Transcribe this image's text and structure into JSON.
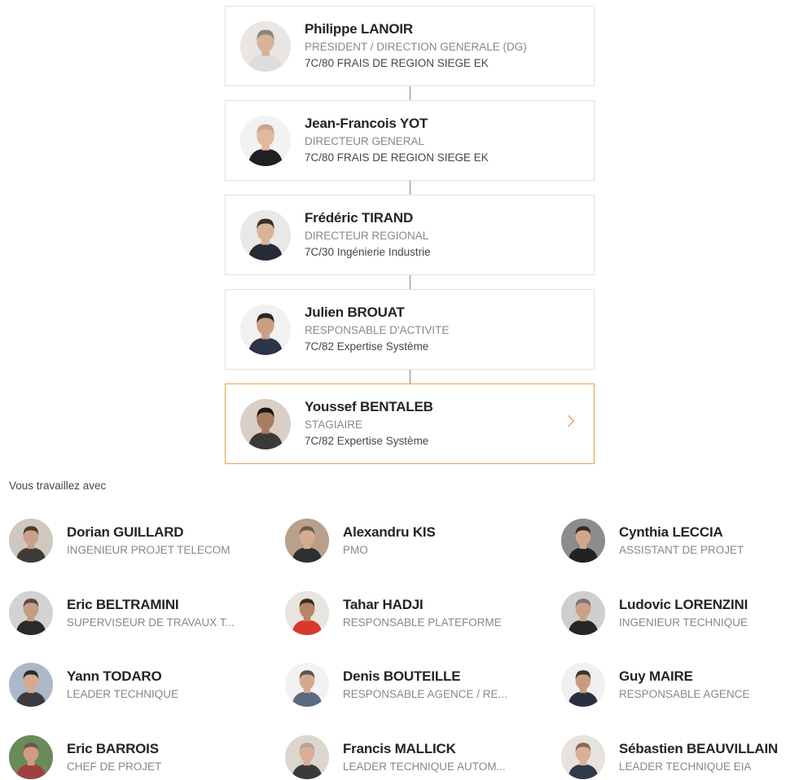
{
  "manager_chain": [
    {
      "name": "Philippe LANOIR",
      "role": "PRESIDENT / DIRECTION GENERALE (DG)",
      "dept": "7C/80 FRAIS DE REGION SIEGE EK",
      "avatar_icon": "person-photo-avatar",
      "bg": "#e9e6e3",
      "skin": "#d7b39a",
      "hair": "#8a8580",
      "shirt": "#dcdcdc"
    },
    {
      "name": "Jean-Francois YOT",
      "role": "DIRECTEUR GENERAL",
      "dept": "7C/80 FRAIS DE REGION SIEGE EK",
      "avatar_icon": "person-photo-avatar",
      "bg": "#f2f2f2",
      "skin": "#e0b8a0",
      "hair": "#c9a58c",
      "shirt": "#1f1f24"
    },
    {
      "name": "Frédéric TIRAND",
      "role": "DIRECTEUR REGIONAL",
      "dept": "7C/30 Ingénierie Industrie",
      "avatar_icon": "person-photo-avatar",
      "bg": "#e8e8e8",
      "skin": "#d9b298",
      "hair": "#3b3029",
      "shirt": "#262b35"
    },
    {
      "name": "Julien BROUAT",
      "role": "RESPONSABLE D'ACTIVITE",
      "dept": "7C/82 Expertise Système",
      "avatar_icon": "person-photo-avatar",
      "bg": "#f1f1f1",
      "skin": "#c9a084",
      "hair": "#2e2520",
      "shirt": "#2d3448"
    },
    {
      "name": "Youssef BENTALEB",
      "role": "STAGIAIRE",
      "dept": "7C/82 Expertise Système",
      "avatar_icon": "person-photo-avatar",
      "bg": "#d9cfc6",
      "skin": "#a97d60",
      "hair": "#1f1815",
      "shirt": "#3a3a3a",
      "selected": true
    }
  ],
  "section_label": "Vous travaillez avec",
  "coworkers": [
    {
      "name": "Dorian GUILLARD",
      "role": "INGENIEUR PROJET TELECOM",
      "avatar_icon": "person-photo-avatar",
      "bg": "#cfc8c0",
      "skin": "#c9a08a",
      "hair": "#4a3b30",
      "shirt": "#3e3b38"
    },
    {
      "name": "Alexandru KIS",
      "role": "PMO",
      "avatar_icon": "person-photo-avatar",
      "bg": "#b9a08b",
      "skin": "#d6ab92",
      "hair": "#6b5a50",
      "shirt": "#2f2f33"
    },
    {
      "name": "Cynthia LECCIA",
      "role": "ASSISTANT DE PROJET",
      "avatar_icon": "person-photo-avatar",
      "bg": "#8c8c8c",
      "skin": "#d2a88c",
      "hair": "#3a2a22",
      "shirt": "#222222"
    },
    {
      "name": "Eric BELTRAMINI",
      "role": "SUPERVISEUR DE TRAVAUX T...",
      "avatar_icon": "person-photo-avatar",
      "bg": "#d2d2d2",
      "skin": "#c69c83",
      "hair": "#5a4a42",
      "shirt": "#2a2a2a"
    },
    {
      "name": "Tahar HADJI",
      "role": "RESPONSABLE PLATEFORME",
      "avatar_icon": "person-photo-avatar",
      "bg": "#e8e4e0",
      "skin": "#b88466",
      "hair": "#3d2c22",
      "shirt": "#d63a2a"
    },
    {
      "name": "Ludovic LORENZINI",
      "role": "INGENIEUR TECHNIQUE",
      "avatar_icon": "person-photo-avatar",
      "bg": "#cfcfcf",
      "skin": "#caa186",
      "hair": "#7d7670",
      "shirt": "#262626"
    },
    {
      "name": "Yann TODARO",
      "role": "LEADER TECHNIQUE",
      "avatar_icon": "person-photo-avatar",
      "bg": "#aab8c8",
      "skin": "#d4a98f",
      "hair": "#2e2a28",
      "shirt": "#3a3a40"
    },
    {
      "name": "Denis BOUTEILLE",
      "role": "RESPONSABLE AGENCE / RE...",
      "avatar_icon": "person-photo-avatar",
      "bg": "#f2f2f2",
      "skin": "#d3a98d",
      "hair": "#5c5550",
      "shirt": "#5a6a80"
    },
    {
      "name": "Guy MAIRE",
      "role": "RESPONSABLE AGENCE",
      "avatar_icon": "person-photo-avatar",
      "bg": "#f0f0f0",
      "skin": "#c99c7f",
      "hair": "#3a3432",
      "shirt": "#2a3040"
    },
    {
      "name": "Eric BARROIS",
      "role": "CHEF DE PROJET",
      "avatar_icon": "person-photo-avatar",
      "bg": "#6b8a5a",
      "skin": "#cf9d80",
      "hair": "#6a5a4c",
      "shirt": "#a04040"
    },
    {
      "name": "Francis MALLICK",
      "role": "LEADER TECHNIQUE AUTOM...",
      "avatar_icon": "person-photo-avatar",
      "bg": "#ddd6cf",
      "skin": "#d8ae95",
      "hair": "#b0a398",
      "shirt": "#3a3a3a"
    },
    {
      "name": "Sébastien BEAUVILLAIN",
      "role": "LEADER TECHNIQUE EIA",
      "avatar_icon": "person-photo-avatar",
      "bg": "#e6e2de",
      "skin": "#dab096",
      "hair": "#8a6a50",
      "shirt": "#2f3a4a"
    }
  ]
}
